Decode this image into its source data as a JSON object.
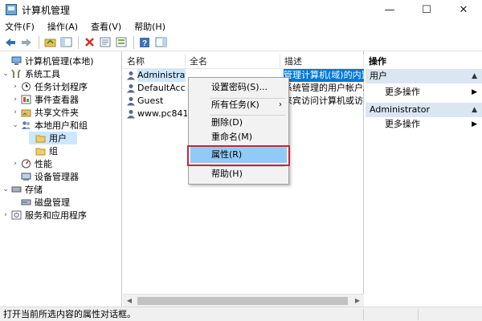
{
  "window": {
    "title": "计算机管理",
    "minimize": "—",
    "maximize": "☐",
    "close": "✕"
  },
  "menubar": [
    "文件(F)",
    "操作(A)",
    "查看(V)",
    "帮助(H)"
  ],
  "tree": {
    "items": [
      {
        "label": "计算机管理(本地)"
      },
      {
        "label": "系统工具"
      },
      {
        "label": "任务计划程序"
      },
      {
        "label": "事件查看器"
      },
      {
        "label": "共享文件夹"
      },
      {
        "label": "本地用户和组"
      },
      {
        "label": "用户"
      },
      {
        "label": "组"
      },
      {
        "label": "性能"
      },
      {
        "label": "设备管理器"
      },
      {
        "label": "存储"
      },
      {
        "label": "磁盘管理"
      },
      {
        "label": "服务和应用程序"
      }
    ]
  },
  "list": {
    "columns": [
      "名称",
      "全名",
      "描述"
    ],
    "rows": [
      {
        "name": "Administrat...",
        "fullname": "",
        "desc": "管理计算机(域)的内置帐"
      },
      {
        "name": "DefaultAcc...",
        "fullname": "",
        "desc": "系统管理的用户帐户。"
      },
      {
        "name": "Guest",
        "fullname": "",
        "desc": "来宾访问计算机或访"
      },
      {
        "name": "www.pc841....",
        "fullname": "",
        "desc": ""
      }
    ]
  },
  "context_menu": {
    "items": [
      {
        "label": "设置密码(S)..."
      },
      {
        "label": "所有任务(K)",
        "submenu": "›"
      },
      {
        "label": "删除(D)"
      },
      {
        "label": "重命名(M)"
      },
      {
        "label": "属性(R)"
      },
      {
        "label": "帮助(H)"
      }
    ]
  },
  "actions": {
    "header": "操作",
    "groups": [
      {
        "title": "用户",
        "link": "更多操作"
      },
      {
        "title": "Administrator",
        "link": "更多操作"
      }
    ]
  },
  "statusbar": {
    "text": "打开当前所选内容的属性对话框。"
  },
  "colors": {
    "selection": "#cce8ff",
    "highlight_blue": "#0078d7",
    "action_group_bg": "#dbe6f3",
    "menu_highlight": "#91c9f7",
    "callout_red": "#c0283d"
  }
}
